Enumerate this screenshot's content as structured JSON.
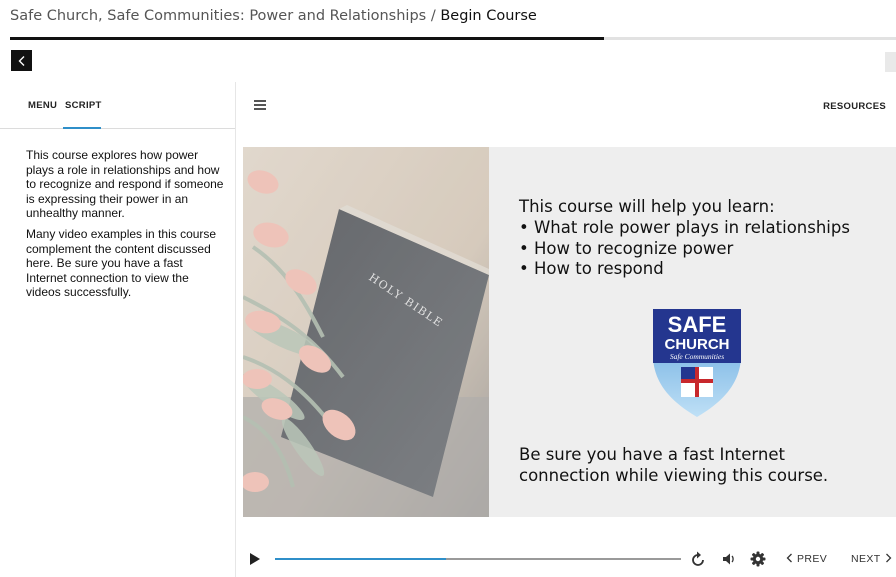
{
  "header": {
    "course_title": "Safe Church, Safe Communities: Power and Relationships",
    "separator": " / ",
    "current_section": "Begin Course",
    "progress_fraction": 0.67
  },
  "sidebar": {
    "tabs": [
      {
        "label": "MENU",
        "active": false
      },
      {
        "label": "SCRIPT",
        "active": true
      }
    ],
    "script_paragraphs": [
      "This course explores how power plays a role in relationships and how to recognize and respond if someone is expressing their power in an unhealthy manner.",
      "Many video examples in this course complement the content discussed here. Be sure you have a fast Internet connection to view the videos successfully."
    ]
  },
  "main": {
    "resources_label": "RESOURCES"
  },
  "slide": {
    "heading": "This course will help you learn:",
    "bullets": [
      "What role power plays in relationships",
      "How to recognize power",
      "How to respond"
    ],
    "footer": "Be sure you have a fast Internet connection while viewing this course.",
    "photo_text": "HOLY BIBLE",
    "logo": {
      "line1": "SAFE",
      "line2": "CHURCH",
      "line3": "Safe Communities"
    }
  },
  "player": {
    "progress_fraction": 0.42,
    "prev_label": "PREV",
    "next_label": "NEXT"
  },
  "colors": {
    "accent": "#2f8fc9",
    "logo_blue": "#24368f"
  },
  "icons": [
    "chevron-left-icon",
    "hamburger-icon",
    "play-icon",
    "replay-icon",
    "volume-icon",
    "gear-icon",
    "chevron-right-icon"
  ]
}
